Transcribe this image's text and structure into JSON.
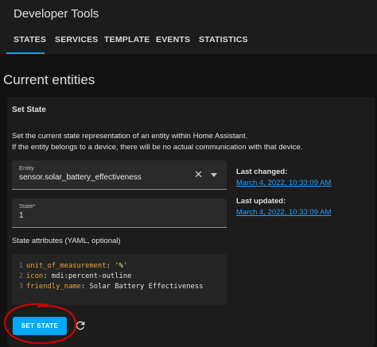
{
  "header": {
    "title": "Developer Tools",
    "tabs": [
      {
        "label": "STATES"
      },
      {
        "label": "SERVICES"
      },
      {
        "label": "TEMPLATE"
      },
      {
        "label": "EVENTS"
      },
      {
        "label": "STATISTICS"
      }
    ],
    "active_tab": "STATES"
  },
  "page": {
    "heading": "Current entities"
  },
  "card": {
    "title": "Set State",
    "description_line1": "Set the current state representation of an entity within Home Assistant.",
    "description_line2": "If the entity belongs to a device, there will be no actual communication with that device.",
    "entity_field": {
      "label": "Entity",
      "value": "sensor.solar_battery_effectiveness"
    },
    "state_field": {
      "label": "State*",
      "value": "1"
    },
    "last_changed": {
      "label": "Last changed:",
      "value": "March 4, 2022, 10:33:09 AM"
    },
    "last_updated": {
      "label": "Last updated:",
      "value": "March 4, 2022, 10:33:09 AM"
    },
    "attributes_label": "State attributes (YAML, optional)",
    "yaml": [
      {
        "line": "1",
        "key": "unit_of_measurement",
        "sep": ": ",
        "value": "'%'"
      },
      {
        "line": "2",
        "key": "icon",
        "sep": ": ",
        "value": "mdi:percent-outline"
      },
      {
        "line": "3",
        "key": "friendly_name",
        "sep": ": ",
        "value": "Solar Battery Effectiveness"
      }
    ],
    "set_state_label": "SET STATE"
  },
  "icons": {
    "clear": "close-icon",
    "dropdown": "dropdown-arrow-icon",
    "refresh": "refresh-icon"
  },
  "colors": {
    "accent": "#03a9f4",
    "link": "#2a9df4",
    "annotation": "#d10000",
    "yaml_key": "#e8a33d"
  }
}
